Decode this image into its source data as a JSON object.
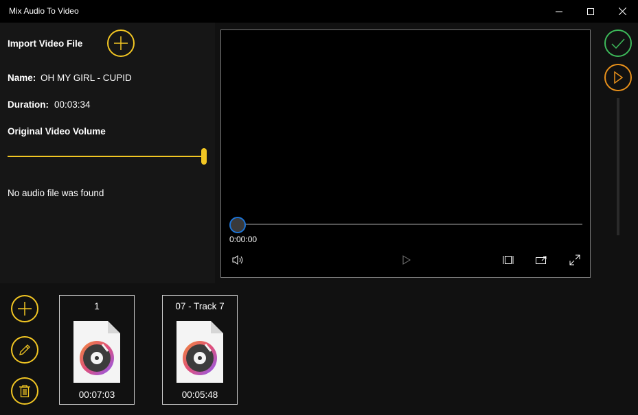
{
  "window": {
    "title": "Mix Audio To Video",
    "minimize_icon": "minimize-icon",
    "maximize_icon": "maximize-icon",
    "close_icon": "close-icon"
  },
  "video": {
    "import_label": "Import Video File",
    "name_label": "Name:",
    "name_value": "OH MY GIRL - CUPID",
    "duration_label": "Duration:",
    "duration_value": "00:03:34",
    "volume_label": "Original Video Volume",
    "volume_level": 1.0,
    "no_audio_text": "No audio file was found"
  },
  "player": {
    "current_time": "0:00:00",
    "progress": 0,
    "controls": [
      "volume-icon",
      "play-icon",
      "aspect-ratio-icon",
      "cast-icon",
      "fullscreen-icon"
    ]
  },
  "actions": {
    "confirm_icon": "checkmark-icon",
    "preview_icon": "play-icon"
  },
  "audio_tools": [
    "add-icon",
    "edit-pencil-icon",
    "delete-trash-icon"
  ],
  "audio_files": [
    {
      "name": "1",
      "duration": "00:07:03"
    },
    {
      "name": "07 - Track 7",
      "duration": "00:05:48"
    }
  ],
  "colors": {
    "accent": "#f2c623",
    "confirm": "#3dba5a",
    "preview": "#e8901a",
    "seek_thumb_border": "#1d74d6"
  }
}
